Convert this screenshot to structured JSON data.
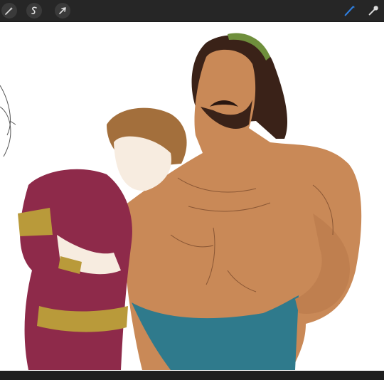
{
  "app": {
    "toolbar": {
      "left_tools": [
        {
          "name": "adjustments",
          "icon": "magic-wand-icon"
        },
        {
          "name": "selection",
          "icon": "s-curve-selection-icon"
        },
        {
          "name": "transform",
          "icon": "arrow-cursor-icon"
        }
      ],
      "right_tools": [
        {
          "name": "brush",
          "icon": "brush-icon",
          "active": true,
          "color": "#2f7fe0"
        },
        {
          "name": "smudge",
          "icon": "smudge-icon",
          "active": false
        }
      ]
    },
    "canvas": {
      "background": "#ffffff",
      "palette": {
        "skin_dark": "#c98957",
        "skin_light": "#f7ece0",
        "hair_dark": "#3a2218",
        "hair_light": "#a36f3c",
        "robe": "#8e2a4a",
        "gold": "#b99a3a",
        "cloth": "#2f7a8c",
        "laurel_green": "#6f8f3c"
      }
    }
  }
}
